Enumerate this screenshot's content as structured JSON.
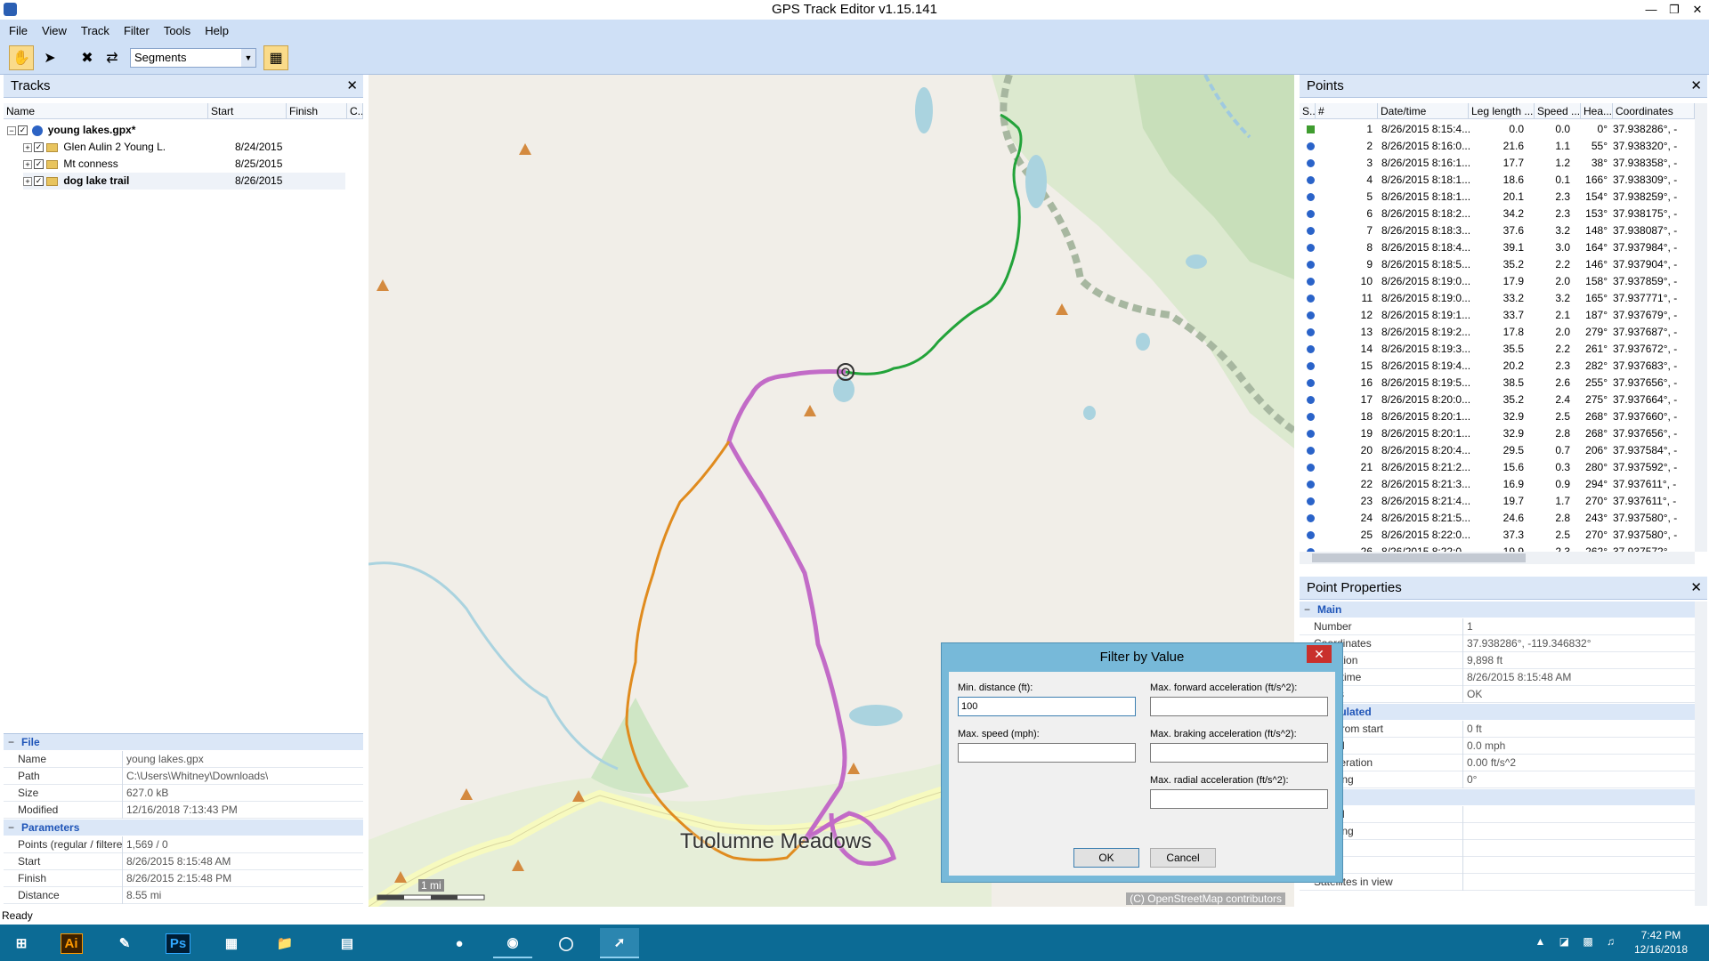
{
  "window": {
    "title": "GPS Track Editor v1.15.141"
  },
  "menu": [
    "File",
    "View",
    "Track",
    "Filter",
    "Tools",
    "Help"
  ],
  "toolbar": {
    "mode_value": "Segments"
  },
  "tracks_panel": {
    "title": "Tracks",
    "columns": [
      "Name",
      "Start",
      "Finish",
      "C..."
    ],
    "root": "young lakes.gpx*",
    "items": [
      {
        "name": "Glen Aulin 2 Young L.",
        "start": "8/24/2015"
      },
      {
        "name": "Mt conness",
        "start": "8/25/2015"
      },
      {
        "name": "dog lake trail",
        "start": "8/26/2015"
      }
    ]
  },
  "file_props": {
    "section_file": "File",
    "rows": [
      {
        "k": "Name",
        "v": "young lakes.gpx"
      },
      {
        "k": "Path",
        "v": "C:\\Users\\Whitney\\Downloads\\"
      },
      {
        "k": "Size",
        "v": "627.0 kB"
      },
      {
        "k": "Modified",
        "v": "12/16/2018 7:13:43 PM"
      }
    ],
    "section_params": "Parameters",
    "params": [
      {
        "k": "Points (regular / filtere",
        "v": "1,569 / 0"
      },
      {
        "k": "Start",
        "v": "8/26/2015 8:15:48 AM"
      },
      {
        "k": "Finish",
        "v": "8/26/2015 2:15:48 PM"
      },
      {
        "k": "Distance",
        "v": "8.55 mi"
      }
    ]
  },
  "map": {
    "place_label": "Tuolumne Meadows",
    "scale_label": "1 mi",
    "attribution": "(C) OpenStreetMap contributors"
  },
  "points_panel": {
    "title": "Points",
    "columns": [
      "S...",
      "#",
      "Date/time",
      "Leg length ...",
      "Speed ...",
      "Hea...",
      "Coordinates"
    ],
    "rows": [
      [
        "1",
        "8/26/2015 8:15:4...",
        "0.0",
        "0.0",
        "0°",
        "37.938286°, -"
      ],
      [
        "2",
        "8/26/2015 8:16:0...",
        "21.6",
        "1.1",
        "55°",
        "37.938320°, -"
      ],
      [
        "3",
        "8/26/2015 8:16:1...",
        "17.7",
        "1.2",
        "38°",
        "37.938358°, -"
      ],
      [
        "4",
        "8/26/2015 8:18:1...",
        "18.6",
        "0.1",
        "166°",
        "37.938309°, -"
      ],
      [
        "5",
        "8/26/2015 8:18:1...",
        "20.1",
        "2.3",
        "154°",
        "37.938259°, -"
      ],
      [
        "6",
        "8/26/2015 8:18:2...",
        "34.2",
        "2.3",
        "153°",
        "37.938175°, -"
      ],
      [
        "7",
        "8/26/2015 8:18:3...",
        "37.6",
        "3.2",
        "148°",
        "37.938087°, -"
      ],
      [
        "8",
        "8/26/2015 8:18:4...",
        "39.1",
        "3.0",
        "164°",
        "37.937984°, -"
      ],
      [
        "9",
        "8/26/2015 8:18:5...",
        "35.2",
        "2.2",
        "146°",
        "37.937904°, -"
      ],
      [
        "10",
        "8/26/2015 8:19:0...",
        "17.9",
        "2.0",
        "158°",
        "37.937859°, -"
      ],
      [
        "11",
        "8/26/2015 8:19:0...",
        "33.2",
        "3.2",
        "165°",
        "37.937771°, -"
      ],
      [
        "12",
        "8/26/2015 8:19:1...",
        "33.7",
        "2.1",
        "187°",
        "37.937679°, -"
      ],
      [
        "13",
        "8/26/2015 8:19:2...",
        "17.8",
        "2.0",
        "279°",
        "37.937687°, -"
      ],
      [
        "14",
        "8/26/2015 8:19:3...",
        "35.5",
        "2.2",
        "261°",
        "37.937672°, -"
      ],
      [
        "15",
        "8/26/2015 8:19:4...",
        "20.2",
        "2.3",
        "282°",
        "37.937683°, -"
      ],
      [
        "16",
        "8/26/2015 8:19:5...",
        "38.5",
        "2.6",
        "255°",
        "37.937656°, -"
      ],
      [
        "17",
        "8/26/2015 8:20:0...",
        "35.2",
        "2.4",
        "275°",
        "37.937664°, -"
      ],
      [
        "18",
        "8/26/2015 8:20:1...",
        "32.9",
        "2.5",
        "268°",
        "37.937660°, -"
      ],
      [
        "19",
        "8/26/2015 8:20:1...",
        "32.9",
        "2.8",
        "268°",
        "37.937656°, -"
      ],
      [
        "20",
        "8/26/2015 8:20:4...",
        "29.5",
        "0.7",
        "206°",
        "37.937584°, -"
      ],
      [
        "21",
        "8/26/2015 8:21:2...",
        "15.6",
        "0.3",
        "280°",
        "37.937592°, -"
      ],
      [
        "22",
        "8/26/2015 8:21:3...",
        "16.9",
        "0.9",
        "294°",
        "37.937611°, -"
      ],
      [
        "23",
        "8/26/2015 8:21:4...",
        "19.7",
        "1.7",
        "270°",
        "37.937611°, -"
      ],
      [
        "24",
        "8/26/2015 8:21:5...",
        "24.6",
        "2.8",
        "243°",
        "37.937580°, -"
      ],
      [
        "25",
        "8/26/2015 8:22:0...",
        "37.3",
        "2.5",
        "270°",
        "37.937580°, -"
      ],
      [
        "26",
        "8/26/2015 8:22:0...",
        "19.9",
        "2.3",
        "262°",
        "37.937572°, -"
      ]
    ]
  },
  "point_props": {
    "title": "Point Properties",
    "section_main": "Main",
    "rows": [
      {
        "k": "Number",
        "v": "1"
      },
      {
        "k": "Coordinates",
        "v": "37.938286°, -119.346832°"
      },
      {
        "k": "Elevation",
        "v": "9,898 ft"
      },
      {
        "k": "Point time",
        "v": "8/26/2015 8:15:48 AM"
      },
      {
        "k": "Status",
        "v": "OK"
      }
    ],
    "section_calc": "Calculated",
    "calc_rows": [
      {
        "k": "Dist. from start",
        "v": "0 ft"
      },
      {
        "k": "Speed",
        "v": "0.0 mph"
      },
      {
        "k": "Acceleration",
        "v": "0.00 ft/s^2"
      },
      {
        "k": "Heading",
        "v": "0°"
      }
    ],
    "extra_rows": [
      {
        "k": "Speed",
        "v": ""
      },
      {
        "k": "Heading",
        "v": ""
      },
      {
        "k": "",
        "v": ""
      },
      {
        "k": "",
        "v": ""
      },
      {
        "k": "Satellites in view",
        "v": ""
      }
    ]
  },
  "dialog": {
    "title": "Filter by Value",
    "min_distance_label": "Min. distance (ft):",
    "min_distance_value": "100",
    "max_speed_label": "Max. speed (mph):",
    "max_fwd_label": "Max. forward acceleration (ft/s^2):",
    "max_brake_label": "Max. braking acceleration (ft/s^2):",
    "max_radial_label": "Max. radial acceleration (ft/s^2):",
    "ok": "OK",
    "cancel": "Cancel"
  },
  "status": {
    "text": "Ready"
  },
  "taskbar": {
    "time": "7:42 PM",
    "date": "12/16/2018"
  }
}
